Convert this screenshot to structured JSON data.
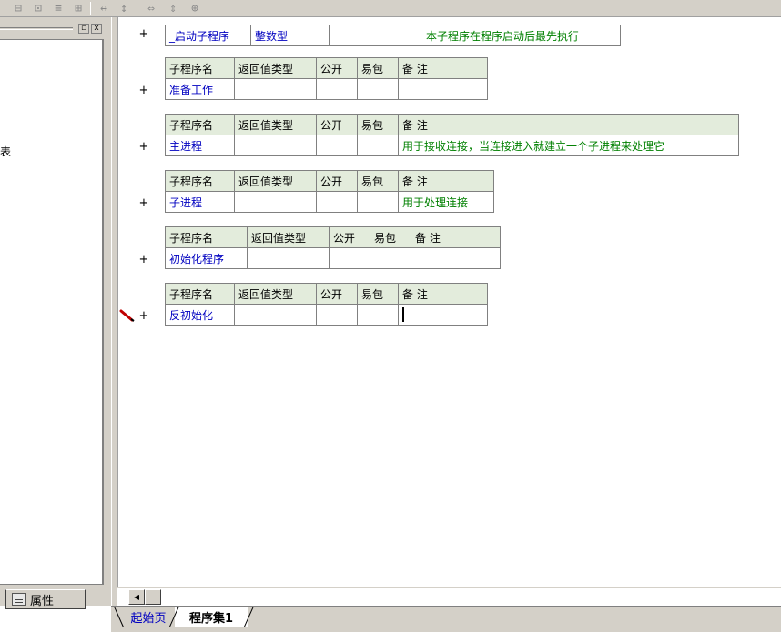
{
  "toolbar": {
    "icons": [
      "align-icon",
      "center-icon",
      "distribute-icon",
      "stack-icon",
      "width-icon",
      "height-icon",
      "hsize-icon",
      "vsize-icon",
      "grid-icon"
    ]
  },
  "left_pane": {
    "fragment_text": "表",
    "pin_glyph": "▫",
    "close_glyph": "x",
    "property_tab_label": "属性"
  },
  "tables": [
    {
      "header": null,
      "row": [
        "_启动子程序",
        "整数型",
        "",
        "",
        "本子程序在程序启动后最先执行"
      ]
    },
    {
      "header": [
        "子程序名",
        "返回值类型",
        "公开",
        "易包",
        "备 注"
      ],
      "row": [
        "准备工作",
        "",
        "",
        "",
        ""
      ]
    },
    {
      "header": [
        "子程序名",
        "返回值类型",
        "公开",
        "易包",
        "备 注"
      ],
      "row": [
        "主进程",
        "",
        "",
        "",
        "用于接收连接，当连接进入就建立一个子进程来处理它"
      ]
    },
    {
      "header": [
        "子程序名",
        "返回值类型",
        "公开",
        "易包",
        "备 注"
      ],
      "row": [
        "子进程",
        "",
        "",
        "",
        "用于处理连接"
      ]
    },
    {
      "header": [
        "子程序名",
        "返回值类型",
        "公开",
        "易包",
        "备 注"
      ],
      "row": [
        "初始化程序",
        "",
        "",
        "",
        ""
      ]
    },
    {
      "header": [
        "子程序名",
        "返回值类型",
        "公开",
        "易包",
        "备 注"
      ],
      "row": [
        "反初始化",
        "",
        "",
        "",
        ""
      ]
    }
  ],
  "expand_glyph": "+",
  "tabs": {
    "home": "起始页",
    "active": "程序集1"
  },
  "scroll": {
    "left_arrow": "◀"
  },
  "colors": {
    "header_bg": "#e3ecdc",
    "name_color": "#0000c0",
    "comment_color": "#008000",
    "pen_color": "#c00000"
  }
}
